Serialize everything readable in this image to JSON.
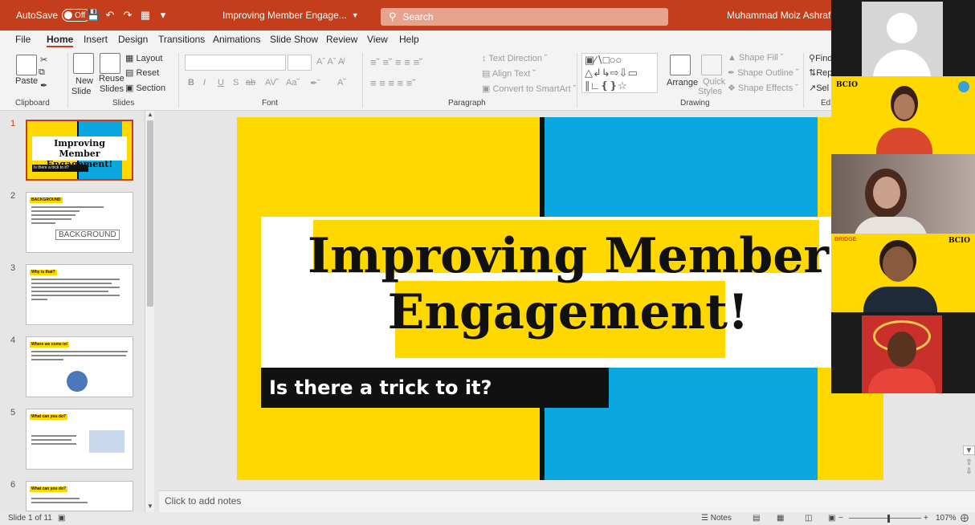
{
  "titlebar": {
    "autosave_label": "AutoSave",
    "autosave_state": "Off",
    "doc_title": "Improving Member Engage...",
    "search_placeholder": "Search",
    "user_name": "Muhammad Moiz Ashraf Qazi"
  },
  "menu": {
    "tabs": [
      "File",
      "Home",
      "Insert",
      "Design",
      "Transitions",
      "Animations",
      "Slide Show",
      "Review",
      "View",
      "Help"
    ],
    "active": "Home"
  },
  "ribbon": {
    "clipboard": {
      "paste": "Paste",
      "label": "Clipboard"
    },
    "slides": {
      "new_slide_1": "New",
      "new_slide_2": "Slide",
      "reuse_1": "Reuse",
      "reuse_2": "Slides",
      "layout": "Layout",
      "reset": "Reset",
      "section": "Section",
      "label": "Slides"
    },
    "font": {
      "bold": "B",
      "italic": "I",
      "underline": "U",
      "strike": "S",
      "shadow": "ab",
      "label": "Font"
    },
    "paragraph": {
      "text_direction": "Text Direction",
      "align_text": "Align Text",
      "smartart": "Convert to SmartArt",
      "label": "Paragraph"
    },
    "drawing": {
      "arrange": "Arrange",
      "quick_styles_1": "Quick",
      "quick_styles_2": "Styles",
      "shape_fill": "Shape Fill",
      "shape_outline": "Shape Outline",
      "shape_effects": "Shape Effects",
      "label": "Drawing"
    },
    "editing": {
      "find": "Find",
      "replace": "Rep",
      "select": "Sel",
      "label": "Ed"
    }
  },
  "thumbnails": [
    {
      "number": "1",
      "title_line1": "Improving Member",
      "title_line2": "Engagement!",
      "subtitle": "Is there a trick to it?"
    },
    {
      "number": "2",
      "tag": "BACKGROUND",
      "popup": "BACKGROUND"
    },
    {
      "number": "3",
      "tag": "Why is that?"
    },
    {
      "number": "4",
      "tag": "Where we come in!"
    },
    {
      "number": "5",
      "tag": "What can you do?"
    },
    {
      "number": "6",
      "tag": "What can you do?"
    }
  ],
  "slide": {
    "title_line1": "Improving Member",
    "title_line2": "Engagement!",
    "subtitle": "Is there a trick to it?",
    "colors": {
      "yellow": "#ffd800",
      "blue": "#0aa7e0",
      "black": "#111111"
    }
  },
  "notes": {
    "placeholder": "Click to add notes"
  },
  "statusbar": {
    "slide_info": "Slide 1 of 11",
    "notes": "Notes",
    "zoom": "107%"
  },
  "video_panel": {
    "tiles": [
      {
        "label": ""
      },
      {
        "label": "BCIO"
      },
      {
        "label": ""
      },
      {
        "label": "BCIO"
      },
      {
        "label": ""
      }
    ],
    "bridge_label": "BRIDGE"
  }
}
